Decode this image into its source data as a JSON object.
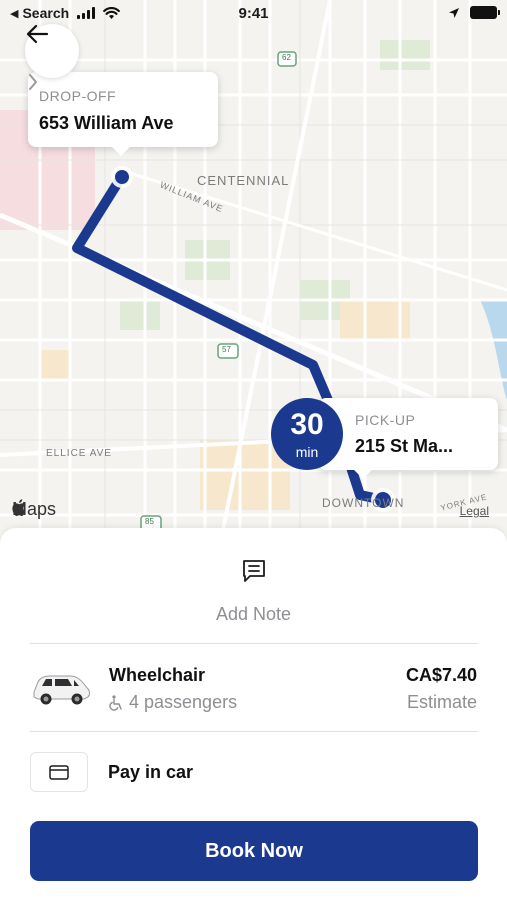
{
  "status_bar": {
    "carrier": "Search",
    "time": "9:41"
  },
  "map": {
    "labels": {
      "centennial": "CENTENNIAL",
      "william_ave": "WILLIAM AVE",
      "ellice_ave": "ELLICE AVE",
      "downtown": "DOWNTOWN",
      "york_ave": "YORK AVE",
      "highway_62": "62",
      "highway_57": "57",
      "highway_85": "85"
    },
    "maps_logo": "Maps",
    "legal": "Legal",
    "route_color": "#1b3a8f"
  },
  "dropoff": {
    "label": "DROP-OFF",
    "address": "653 William Ave"
  },
  "pickup": {
    "label": "PICK-UP",
    "address": "215 St Ma..."
  },
  "eta": {
    "value": "30",
    "unit": "min"
  },
  "sheet": {
    "note_label": "Add Note",
    "ride": {
      "name": "Wheelchair",
      "passengers": "4 passengers",
      "price": "CA$7.40",
      "price_note": "Estimate"
    },
    "payment": {
      "label": "Pay in car"
    },
    "book_button": "Book Now"
  },
  "colors": {
    "accent": "#1b3a8f",
    "secondary_text": "#8e8e93"
  },
  "icons": {
    "back": "arrow-left-icon",
    "note": "message-square-icon",
    "card": "credit-card-icon",
    "chevron": "chevron-right-icon",
    "wheelchair": "wheelchair-icon",
    "location": "location-arrow-icon"
  }
}
